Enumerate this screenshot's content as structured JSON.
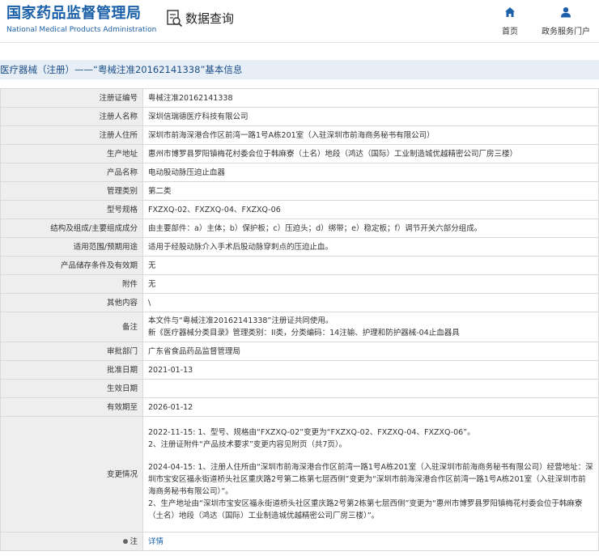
{
  "header": {
    "logo_cn": "国家药品监督管理局",
    "logo_en": "National Medical Products Administration",
    "data_search": "数据查询",
    "nav": [
      {
        "label": "首页",
        "icon": "home-icon"
      },
      {
        "label": "政务服务门户",
        "icon": "user-icon"
      }
    ]
  },
  "colors": {
    "brand": "#1a5fa8",
    "title_bg": "#e8eef5",
    "label_bg": "#eeeeee",
    "border": "#d9d9d9"
  },
  "title": "医疗器械（注册）——“粤械注准20162141338”基本信息",
  "rows": [
    {
      "label": "注册证编号",
      "value": "粤械注准20162141338"
    },
    {
      "label": "注册人名称",
      "value": "深圳信瑞德医疗科技有限公司"
    },
    {
      "label": "注册人住所",
      "value": "深圳市前海深港合作区前湾一路1号A栋201室（入驻深圳市前海商务秘书有限公司）"
    },
    {
      "label": "生产地址",
      "value": "惠州市博罗县罗阳镇梅花村委会位于韩麻寮（土名）地段（鸿达（国际）工业制造城优越精密公司厂房三楼）"
    },
    {
      "label": "产品名称",
      "value": "电动股动脉压迫止血器"
    },
    {
      "label": "管理类别",
      "value": "第二类"
    },
    {
      "label": "型号规格",
      "value": "FXZXQ-02、FXZXQ-04、FXZXQ-06"
    },
    {
      "label": "结构及组成/主要组成成分",
      "value": "由主要部件：a）主体；b）保护板；c）压迫头；d）绑带；e）稳定板；f）调节开关六部分组成。"
    },
    {
      "label": "适用范围/预期用途",
      "value": "适用于经股动脉介入手术后股动脉穿刺点的压迫止血。"
    },
    {
      "label": "产品储存条件及有效期",
      "value": "无"
    },
    {
      "label": "附件",
      "value": "无"
    },
    {
      "label": "其他内容",
      "value": "\\"
    },
    {
      "label": "备注",
      "lines": [
        "本文件与“粤械注准20162141338”注册证共同使用。",
        "新《医疗器械分类目录》管理类别：II类，分类编码：14注输、护理和防护器械-04止血器具"
      ]
    },
    {
      "label": "审批部门",
      "value": "广东省食品药品监督管理局"
    },
    {
      "label": "批准日期",
      "value": "2021-01-13"
    },
    {
      "label": "生效日期",
      "value": ""
    },
    {
      "label": "有效期至",
      "value": "2026-01-12"
    },
    {
      "label": "变更情况",
      "paragraphs": [
        [
          "2022-11-15: 1、型号、规格由“FXZXQ-02”变更为“FXZXQ-02、FXZXQ-04、FXZXQ-06”。",
          "2、注册证附件“产品技术要求”变更内容见附页（共7页）。"
        ],
        [
          "2024-04-15: 1、注册人住所由“深圳市前海深港合作区前湾一路1号A栋201室（入驻深圳市前海商务秘书有限公司）经营地址：深圳市宝安区福永街道桥头社区重庆路2号第二栋第七层西侧”变更为“深圳市前海深港合作区前湾一路1号A栋201室（入驻深圳市前海商务秘书有限公司）”。",
          "2、生产地址由“深圳市宝安区福永街道桥头社区重庆路2号第2栋第七层西侧”变更为“惠州市博罗县罗阳镇梅花村委会位于韩麻寮（土名）地段（鸿达（国际）工业制造城优越精密公司厂房三楼）”。"
        ]
      ]
    },
    {
      "label": "注",
      "link": "详情"
    }
  ]
}
